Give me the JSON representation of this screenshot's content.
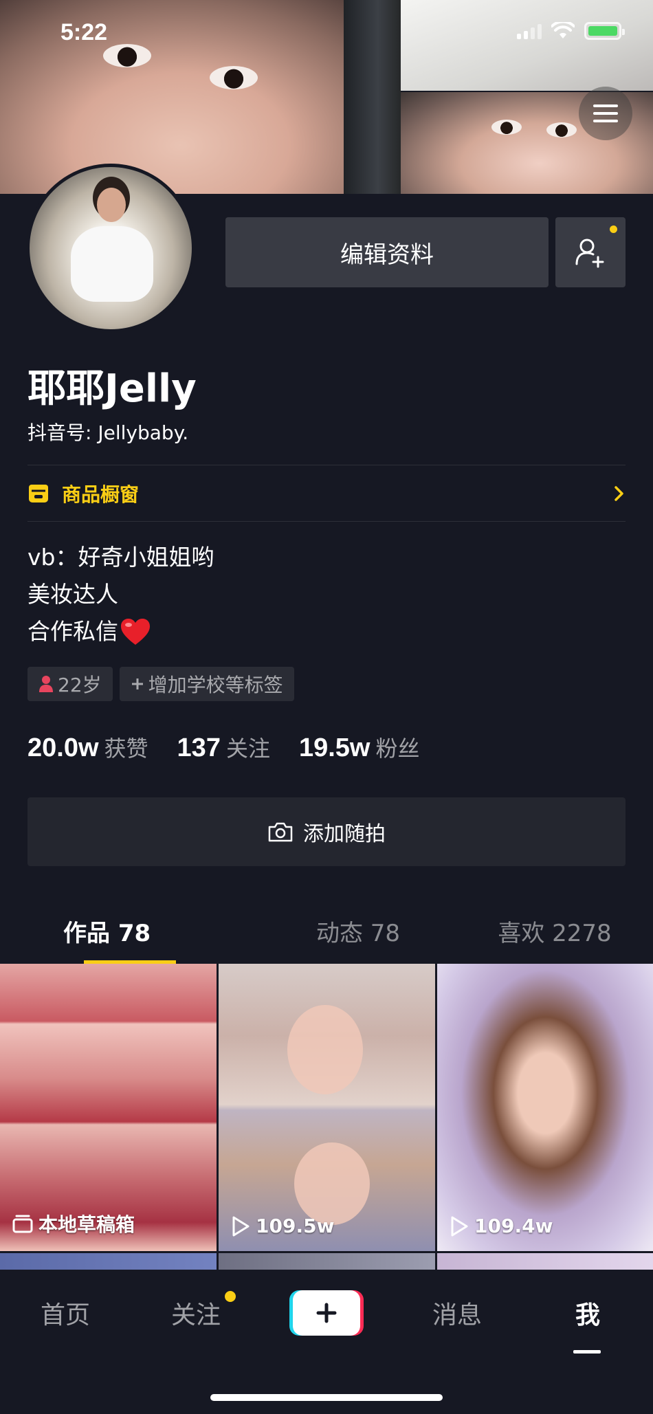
{
  "status_bar": {
    "time": "5:22"
  },
  "profile": {
    "name": "耶耶Jelly",
    "douyin_id": "抖音号: Jellybaby.",
    "edit_button": "编辑资料",
    "shop_label": "商品橱窗",
    "bio_lines": [
      "vb：好奇小姐姐哟",
      "美妆达人",
      "合作私信"
    ],
    "tags": {
      "age": "22岁",
      "add_school": "增加学校等标签"
    },
    "stats": {
      "likes": {
        "num": "20.0w",
        "label": "获赞"
      },
      "following": {
        "num": "137",
        "label": "关注"
      },
      "followers": {
        "num": "19.5w",
        "label": "粉丝"
      }
    },
    "add_snap": "添加随拍"
  },
  "tabs": [
    {
      "label": "作品 78",
      "active": true
    },
    {
      "label": "动态 78",
      "active": false
    },
    {
      "label": "喜欢 2278",
      "active": false
    }
  ],
  "videos": [
    {
      "overlay": "本地草稿箱",
      "icon": "drafts-icon"
    },
    {
      "overlay": "109.5w",
      "icon": "play-icon"
    },
    {
      "overlay": "109.4w",
      "icon": "play-icon"
    }
  ],
  "bottom_nav": {
    "home": "首页",
    "follow": "关注",
    "messages": "消息",
    "me": "我"
  },
  "colors": {
    "accent": "#face15",
    "background": "#161823",
    "button": "#393b44"
  }
}
